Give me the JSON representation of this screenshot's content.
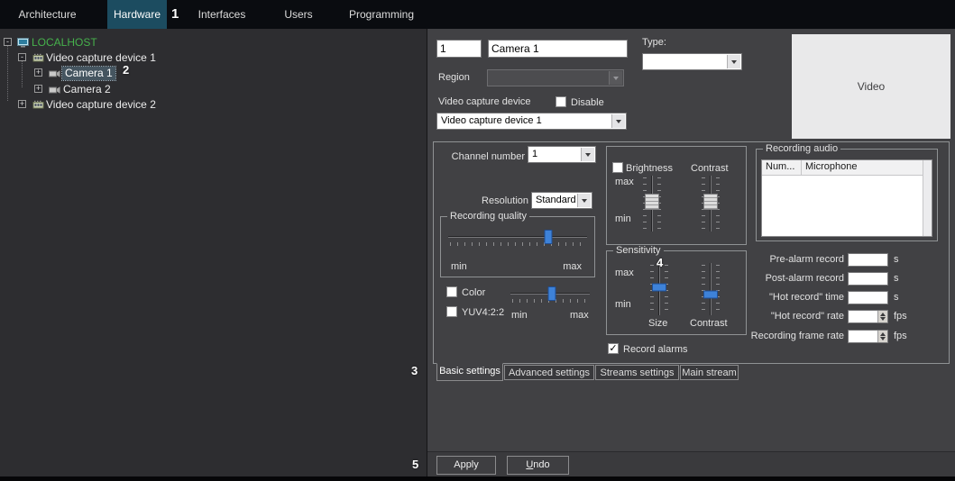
{
  "annotations": {
    "n1": "1",
    "n2": "2",
    "n3": "3",
    "n4": "4",
    "n5": "5"
  },
  "nav": {
    "tabs": [
      {
        "label": "Architecture"
      },
      {
        "label": "Hardware"
      },
      {
        "label": "Interfaces"
      },
      {
        "label": "Users"
      },
      {
        "label": "Programming"
      }
    ]
  },
  "tree": {
    "items": [
      {
        "label": "LOCALHOST",
        "expander": "-"
      },
      {
        "label": "Video capture device 1",
        "expander": "-"
      },
      {
        "label": "Camera 1",
        "expander": "+"
      },
      {
        "label": "Camera 2",
        "expander": "+"
      },
      {
        "label": "Video capture device 2",
        "expander": "+"
      }
    ]
  },
  "header": {
    "id_value": "1",
    "name_value": "Camera 1",
    "type_label": "Type:",
    "region_label": "Region",
    "device_label": "Video capture device",
    "disable_label": "Disable",
    "device_value": "Video capture device 1",
    "video_placeholder": "Video"
  },
  "settings": {
    "channel_label": "Channel number",
    "channel_value": "1",
    "resolution_label": "Resolution",
    "resolution_value": "Standard",
    "recording_quality": {
      "title": "Recording quality",
      "min_label": "min",
      "max_label": "max",
      "value_pct": 72
    },
    "color_label": "Color",
    "yuv_label": "YUV4:2:2",
    "color_min": "min",
    "color_max": "max",
    "color_value_pct": 52,
    "bc": {
      "brightness_label": "Brightness",
      "contrast_label": "Contrast",
      "max_label": "max",
      "min_label": "min",
      "brightness_pct": 47,
      "contrast_pct": 47
    },
    "sensitivity": {
      "title": "Sensitivity",
      "max_label": "max",
      "min_label": "min",
      "size_label": "Size",
      "contrast_label": "Contrast",
      "size_pct": 46,
      "contrast_pct": 60
    },
    "record_alarms_label": "Record alarms",
    "record_alarms_check": "✓",
    "recording_audio": {
      "title": "Recording audio",
      "columns": [
        "Num...",
        "Microphone"
      ]
    },
    "fields": [
      {
        "label": "Pre-alarm record",
        "unit": "s"
      },
      {
        "label": "Post-alarm record",
        "unit": "s"
      },
      {
        "label": "\"Hot record\" time",
        "unit": "s"
      },
      {
        "label": "\"Hot record\" rate",
        "unit": "fps"
      },
      {
        "label": "Recording frame rate",
        "unit": "fps"
      }
    ],
    "tabs": [
      {
        "label": "Basic settings"
      },
      {
        "label": "Advanced settings"
      },
      {
        "label": "Streams settings"
      },
      {
        "label": "Main stream"
      }
    ]
  },
  "footer": {
    "apply_label": "Apply",
    "undo_label": "Undo"
  }
}
